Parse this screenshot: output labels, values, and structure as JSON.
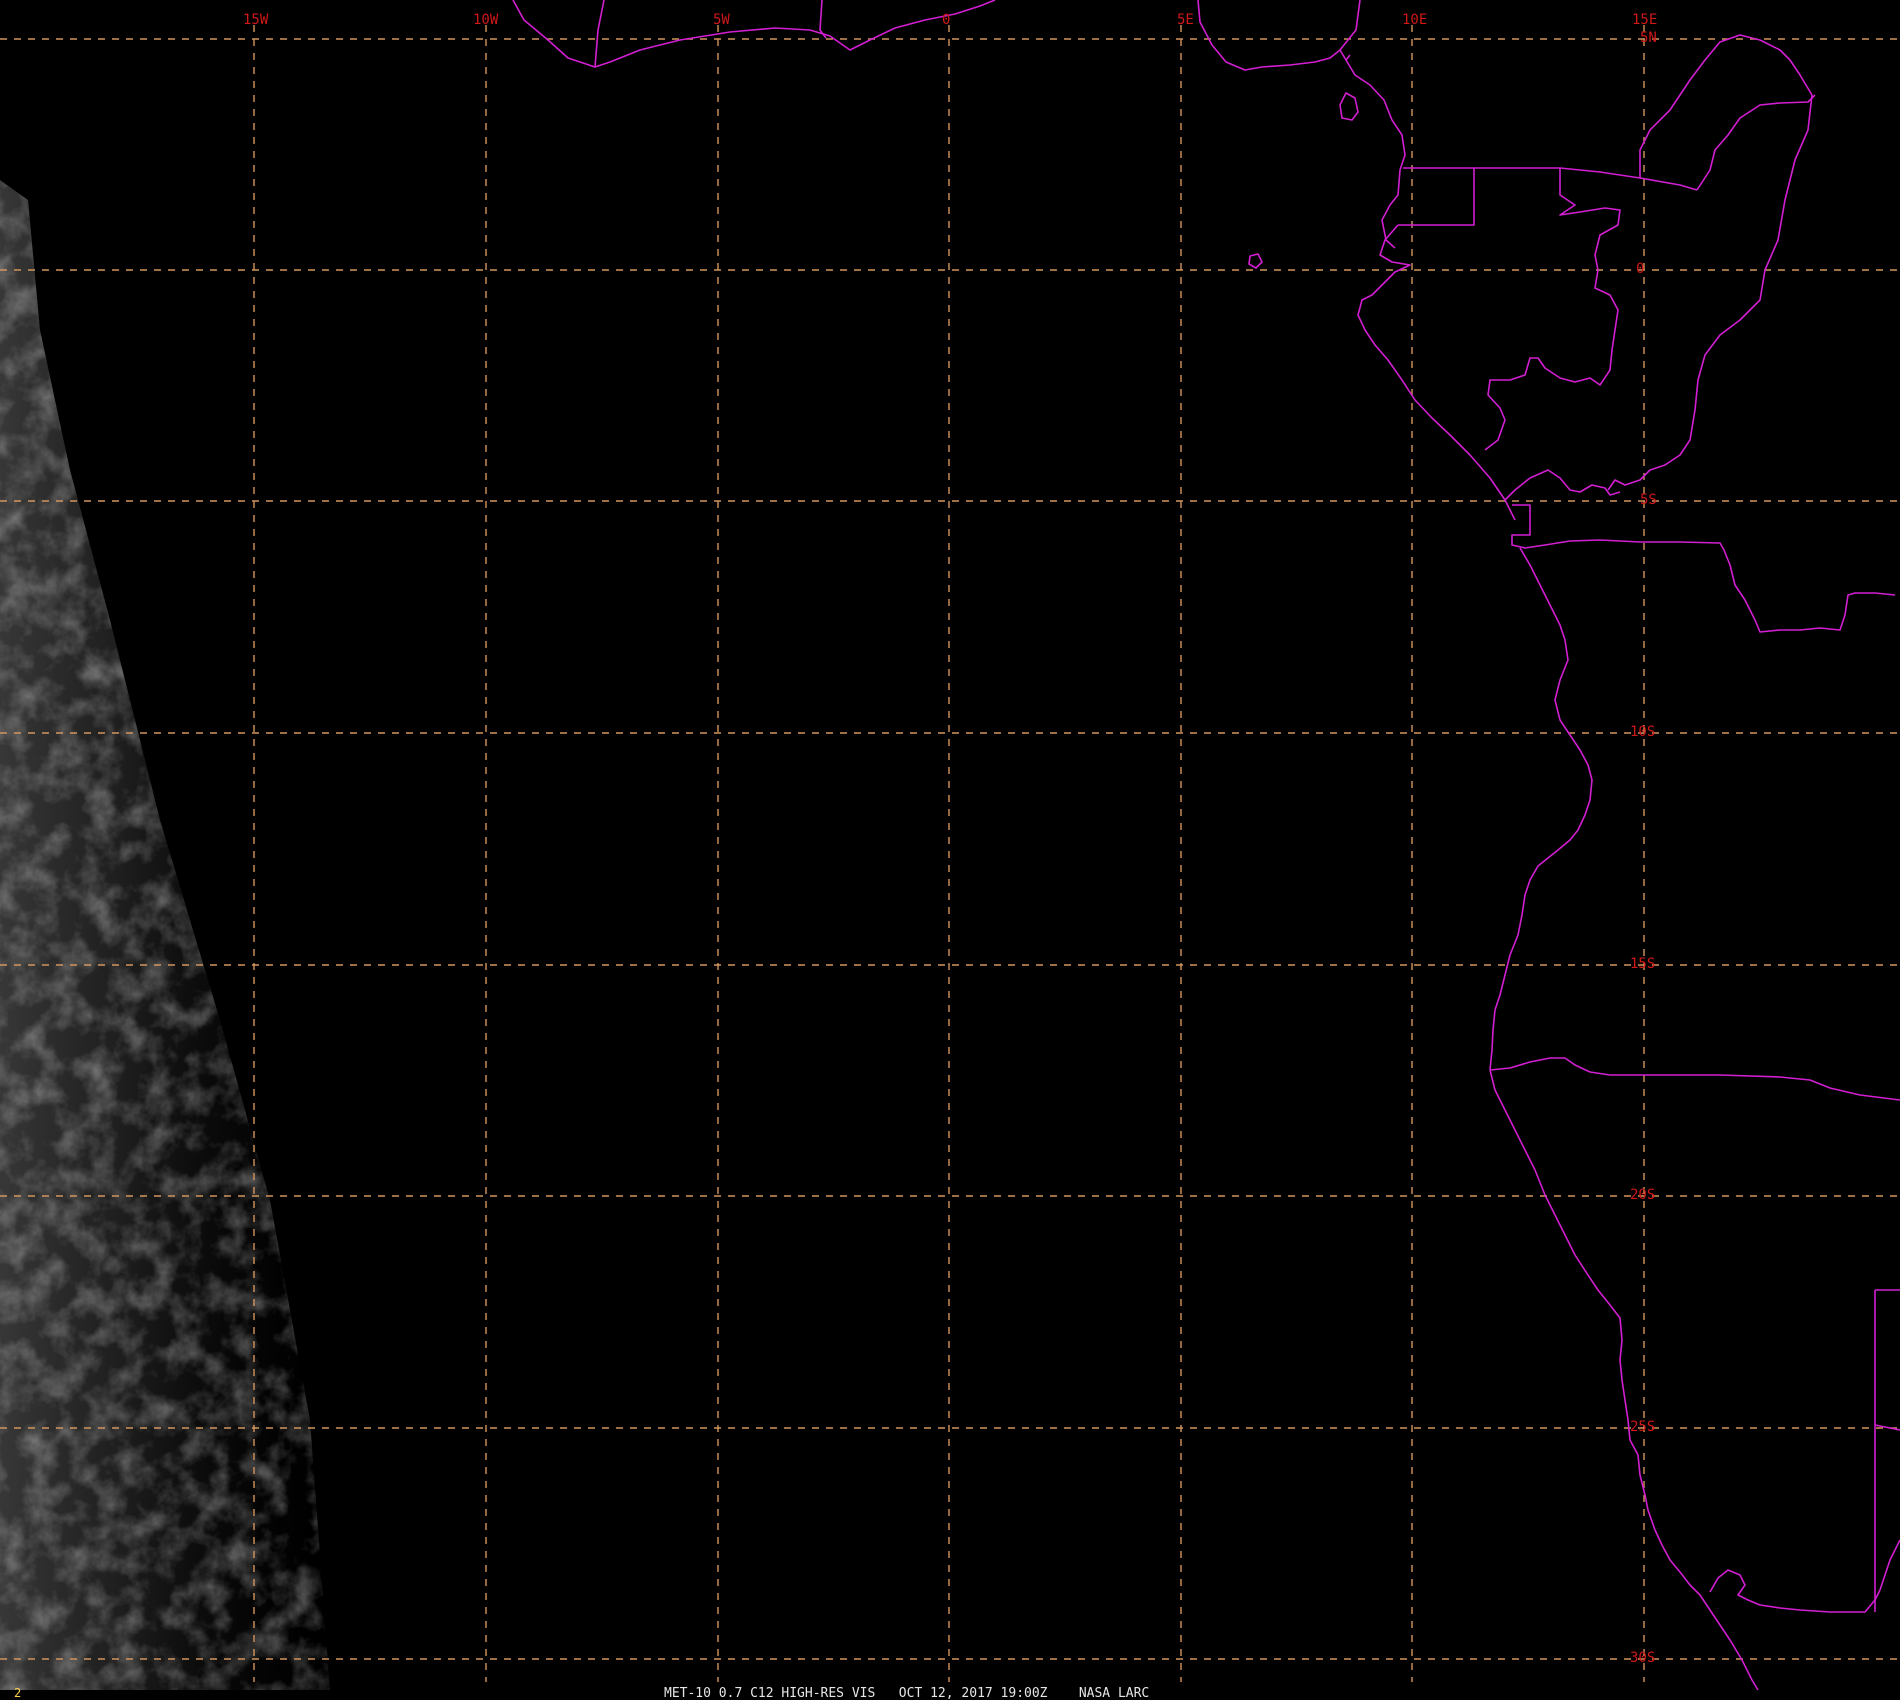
{
  "map": {
    "background_color": "#000000",
    "grid_color": "#d2955c",
    "boundary_color": "#d21fd2",
    "label_color": "#d01818",
    "lon_labels": [
      "15W",
      "10W",
      "5W",
      "0",
      "5E",
      "10E",
      "15E"
    ],
    "lat_labels": [
      "5N",
      "0",
      "5S",
      "10S",
      "15S",
      "20S",
      "25S",
      "30S"
    ],
    "frame_number": "2",
    "caption": "MET-10 0.7 C12 HIGH-RES VIS   OCT 12, 2017 19:00Z    NASA LARC"
  }
}
